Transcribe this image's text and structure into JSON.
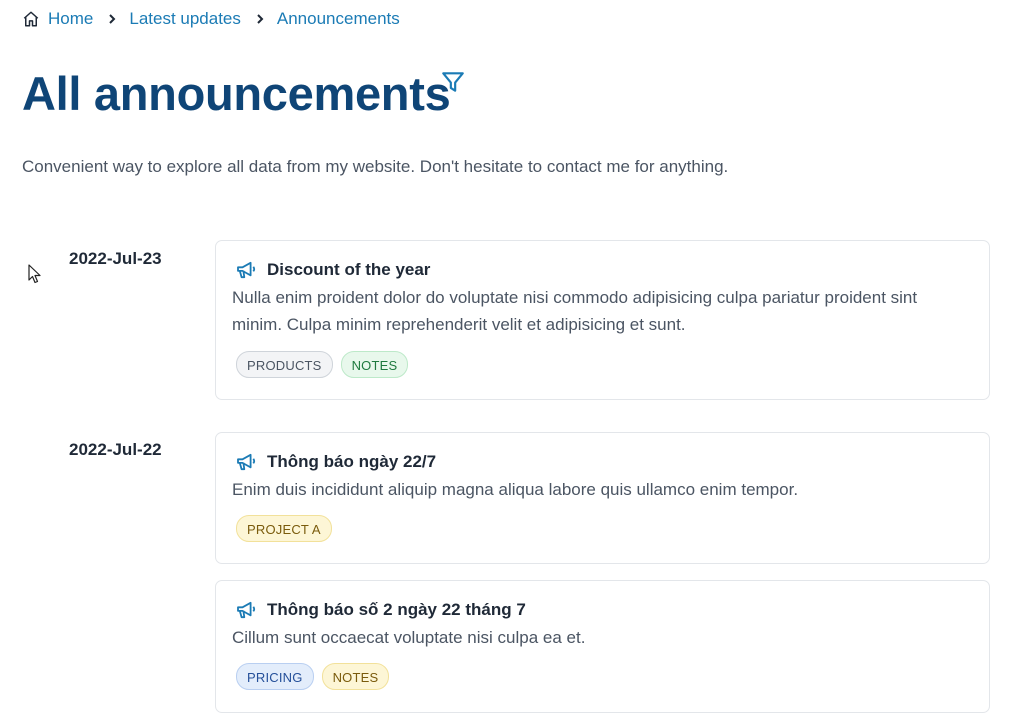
{
  "breadcrumb": {
    "home": "Home",
    "latest": "Latest updates",
    "current": "Announcements"
  },
  "page": {
    "title": "All announcements",
    "subtitle": "Convenient way to explore all data from my website. Don't hesitate to contact me for anything."
  },
  "colors": {
    "accent": "#1b7bb5",
    "title": "#0f4577"
  },
  "groups": [
    {
      "date": "2022-Jul-23",
      "items": [
        {
          "title": "Discount of the year",
          "body": "Nulla enim proident dolor do voluptate nisi commodo adipisicing culpa pariatur proident sint minim. Culpa minim reprehenderit velit et adipisicing et sunt.",
          "tags": [
            "PRODUCTS",
            "NOTES"
          ]
        }
      ]
    },
    {
      "date": "2022-Jul-22",
      "items": [
        {
          "title": "Thông báo ngày 22/7",
          "body": "Enim duis incididunt aliquip magna aliqua labore quis ullamco enim tempor.",
          "tags": [
            "PROJECT A"
          ]
        },
        {
          "title": "Thông báo số 2 ngày 22 tháng 7",
          "body": "Cillum sunt occaecat voluptate nisi culpa ea et.",
          "tags": [
            "PRICING",
            "NOTES"
          ]
        }
      ]
    }
  ],
  "icons": {
    "home": "home-icon",
    "separator": "chevron-right-icon",
    "filter": "filter-icon",
    "announcement": "megaphone-icon",
    "cursor": "mouse-pointer-icon"
  }
}
